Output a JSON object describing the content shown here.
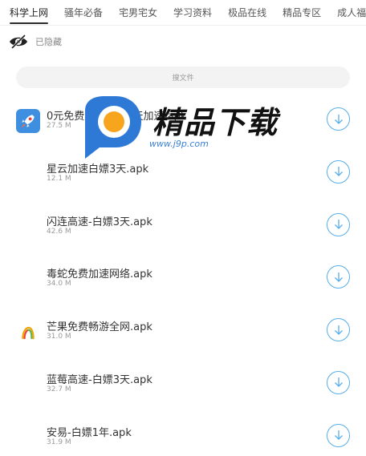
{
  "tabs": [
    {
      "label": "科学上网"
    },
    {
      "label": "骚年必备"
    },
    {
      "label": "宅男宅女"
    },
    {
      "label": "学习资料"
    },
    {
      "label": "极品在线"
    },
    {
      "label": "精品专区"
    },
    {
      "label": "成人福利"
    }
  ],
  "hidden_label": "已隐藏",
  "search": {
    "placeholder": "搜文件"
  },
  "files": [
    {
      "name": "0元免费加速白嫖3天加速.apk",
      "size": "27.5 M",
      "icon": "rocket-icon"
    },
    {
      "name": "星云加速白嫖3天.apk",
      "size": "12.1 M",
      "icon": ""
    },
    {
      "name": "闪连高速-白嫖3天.apk",
      "size": "42.6 M",
      "icon": ""
    },
    {
      "name": "毒蛇免费加速网络.apk",
      "size": "34.0 M",
      "icon": ""
    },
    {
      "name": "芒果免费畅游全网.apk",
      "size": "31.0 M",
      "icon": "mango-icon"
    },
    {
      "name": "蓝莓高速-白嫖3天.apk",
      "size": "32.7 M",
      "icon": ""
    },
    {
      "name": "安易-白嫖1年.apk",
      "size": "31.9 M",
      "icon": ""
    }
  ],
  "watermark": {
    "title": "精品下载",
    "url": "www.j9p.com"
  },
  "colors": {
    "accent": "#58aee8",
    "tab_underline": "#2c2c2c",
    "search_bg": "#f3f3f3"
  }
}
